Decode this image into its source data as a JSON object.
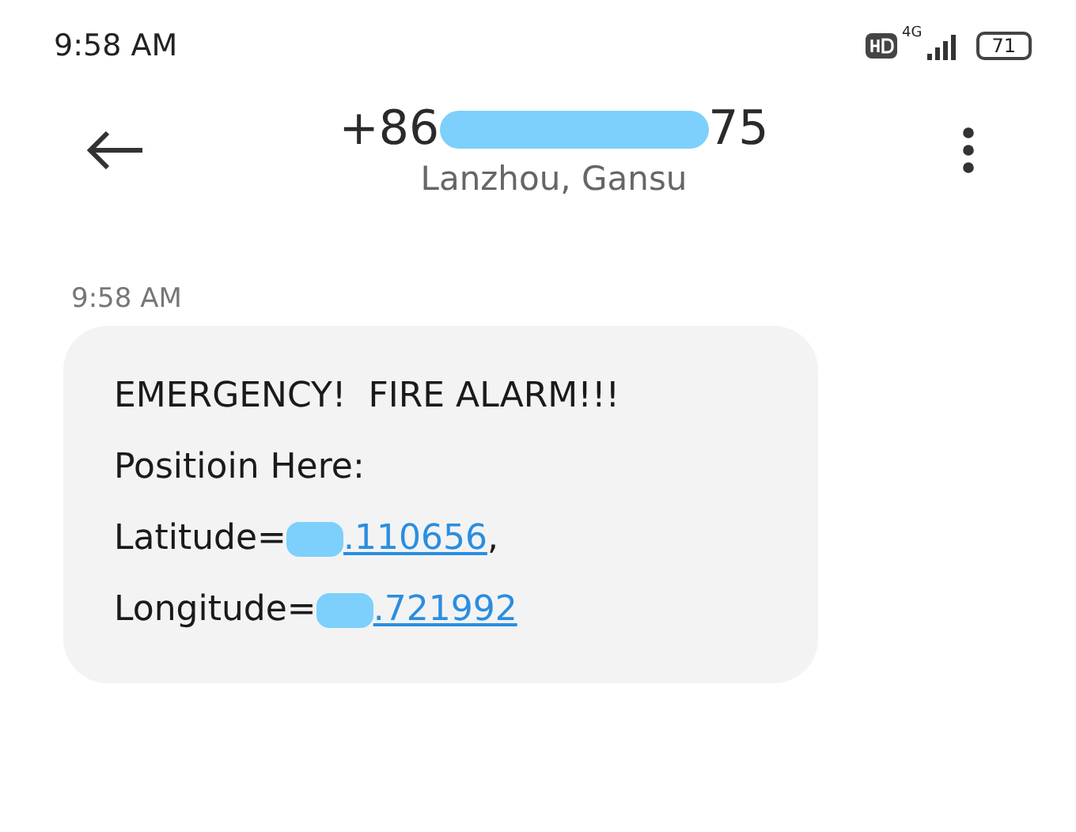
{
  "status_bar": {
    "time": "9:58 AM",
    "network": "4G",
    "battery": "71"
  },
  "header": {
    "number_start": "+86",
    "number_end": "75",
    "location": "Lanzhou, Gansu"
  },
  "messages": [
    {
      "time": "9:58 AM",
      "lines": [
        {
          "kind": "text",
          "text": "EMERGENCY!  FIRE ALARM!!!"
        },
        {
          "kind": "text",
          "text": "Positioin Here:"
        },
        {
          "kind": "link",
          "label": "Latitude=",
          "link": ".110656",
          "after": ","
        },
        {
          "kind": "link",
          "label": "Longitude=",
          "link": ".721992"
        }
      ]
    }
  ]
}
